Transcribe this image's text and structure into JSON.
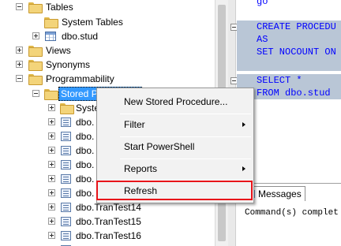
{
  "tree": {
    "tables": "Tables",
    "system_tables": "System Tables",
    "dbo_stud": "dbo.stud",
    "views": "Views",
    "synonyms": "Synonyms",
    "programmability": "Programmability",
    "stored_procedures": "Stored Procedures",
    "system_stored_partial": "Syste",
    "dbo_partial": "dbo.",
    "trantest14": "dbo.TranTest14",
    "trantest15": "dbo.TranTest15",
    "trantest16": "dbo.TranTest16"
  },
  "editor": {
    "line0": "go",
    "line1": "CREATE PROCEDU",
    "line2": "AS",
    "line3": "SET NOCOUNT ON",
    "line5": "SELECT *",
    "line6": "FROM dbo.stud"
  },
  "results": {
    "tab_messages": "Messages",
    "message": "Command(s) complet"
  },
  "context_menu": {
    "new_stored_procedure": "New Stored Procedure...",
    "filter": "Filter",
    "start_powershell": "Start PowerShell",
    "reports": "Reports",
    "refresh": "Refresh"
  },
  "colors": {
    "selection": "#3399ff",
    "highlight_box": "#e8141a",
    "code_highlight": "#b9c6d6",
    "keyword": "#0000ff"
  }
}
